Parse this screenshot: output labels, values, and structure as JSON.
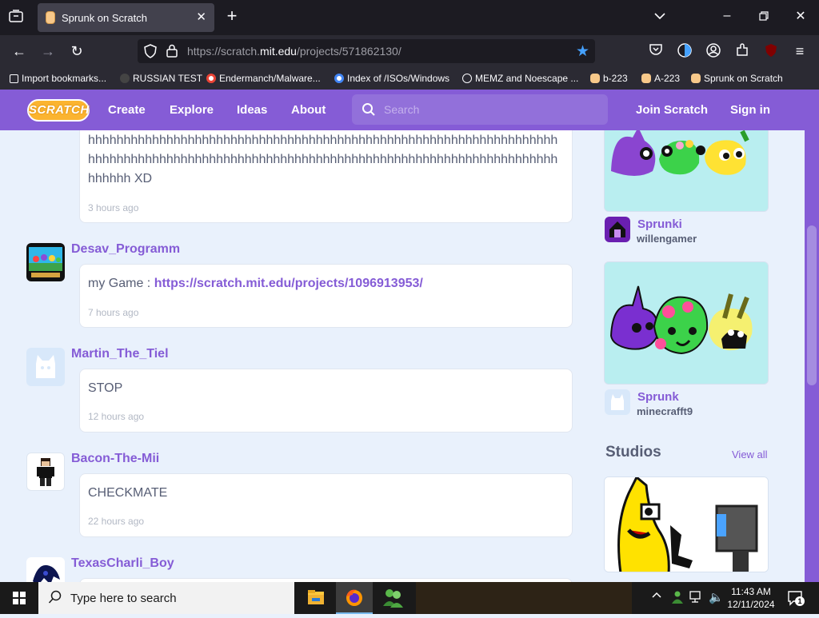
{
  "browser": {
    "tab_title": "Sprunk on Scratch",
    "url_prefix": "https://scratch.",
    "url_domain": "mit.edu",
    "url_path": "/projects/571862130/",
    "bookmarks": [
      {
        "label": "Import bookmarks..."
      },
      {
        "label": "RUSSIAN TEST"
      },
      {
        "label": "Endermanch/Malware..."
      },
      {
        "label": "Index of /ISOs/Windows"
      },
      {
        "label": "MEMZ and Noescape ..."
      },
      {
        "label": "b-223"
      },
      {
        "label": "A-223"
      },
      {
        "label": "Sprunk on Scratch"
      }
    ]
  },
  "scratch_nav": {
    "logo": "SCRATCH",
    "create": "Create",
    "explore": "Explore",
    "ideas": "Ideas",
    "about": "About",
    "search_placeholder": "Search",
    "join": "Join Scratch",
    "signin": "Sign in"
  },
  "comments": [
    {
      "text": "hhhhhhhhhhhhhhhhhhhhhhhhhhhhhhhhhhhhhhhhhhhhhhhhhhhhhhhhhhhhhhhhhhhhhhhhhhhhhhhhhhhhhhhhhhhhhhhhhhhhhhhhhhhhhhhhhhhhhhhhhhhhhhhhhhhhhhhhhh XD",
      "time": "3 hours ago"
    },
    {
      "username": "Desav_Programm",
      "text_prefix": "my Game : ",
      "link": "https://scratch.mit.edu/projects/1096913953/",
      "time": "7 hours ago"
    },
    {
      "username": "Martin_The_Tiel",
      "text": "STOP",
      "time": "12 hours ago"
    },
    {
      "username": "Bacon-The-Mii",
      "text": "CHECKMATE",
      "time": "22 hours ago"
    },
    {
      "username": "TexasCharli_Boy"
    }
  ],
  "sidebar": {
    "remixes": [
      {
        "title": "Sprunki",
        "author": "willengamer"
      },
      {
        "title": "Sprunk",
        "author": "minecrafft9"
      }
    ],
    "studios_heading": "Studios",
    "view_all": "View all"
  },
  "taskbar": {
    "search_placeholder": "Type here to search",
    "time": "11:43 AM",
    "date": "12/11/2024",
    "notification_count": "1"
  }
}
